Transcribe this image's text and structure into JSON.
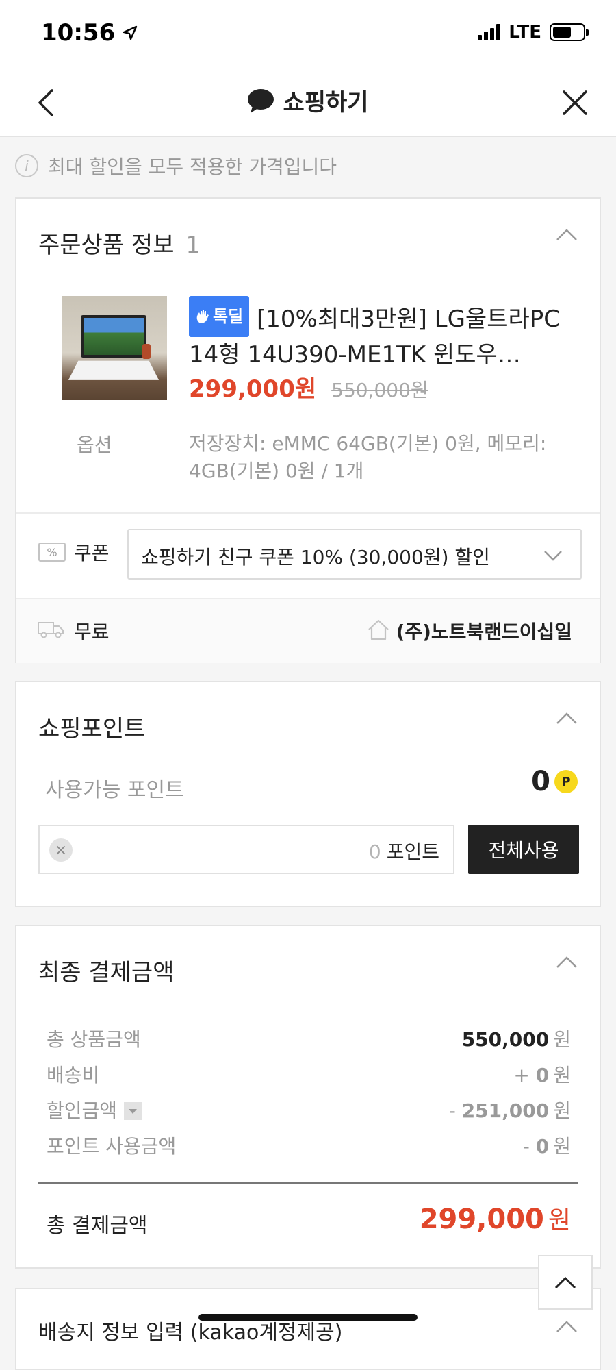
{
  "status_bar": {
    "time": "10:56",
    "network": "LTE"
  },
  "navbar": {
    "title": "쇼핑하기"
  },
  "notice": {
    "text": "최대 할인을 모두 적용한 가격입니다",
    "icon": "info-icon"
  },
  "order": {
    "title": "주문상품 정보",
    "count": "1",
    "product": {
      "badge": "톡딜",
      "name": "[10%최대3만원] LG울트라PC 14형 14U390-ME1TK 윈도우…",
      "sale_price": "299,000원",
      "original_price": "550,000원",
      "option_label": "옵션",
      "option_text": "저장장치: eMMC 64GB(기본) 0원, 메모리: 4GB(기본) 0원 / 1개"
    },
    "coupon": {
      "label": "쿠폰",
      "selected": "쇼핑하기 친구 쿠폰 10% (30,000원) 할인"
    },
    "shipping": {
      "label": "무료",
      "seller": "(주)노트북랜드이십일"
    }
  },
  "points": {
    "title": "쇼핑포인트",
    "available_label": "사용가능 포인트",
    "available_value": "0",
    "point_badge": "P",
    "input_value": "0",
    "input_unit": "포인트",
    "use_all_label": "전체사용"
  },
  "final": {
    "title": "최종 결제금액",
    "rows": [
      {
        "label": "총 상품금액",
        "prefix": "",
        "amount": "550,000",
        "unit": "원"
      },
      {
        "label": "배송비",
        "prefix": "+ ",
        "amount": "0",
        "unit": "원"
      },
      {
        "label": "할인금액",
        "prefix": "- ",
        "amount": "251,000",
        "unit": "원"
      },
      {
        "label": "포인트 사용금액",
        "prefix": "- ",
        "amount": "0",
        "unit": "원"
      }
    ],
    "total_label": "총 결제금액",
    "total_amount": "299,000",
    "total_unit": "원"
  },
  "next_section": {
    "title": "배송지 정보 입력 (kakao계정제공)"
  },
  "colors": {
    "accent_red": "#e0462a",
    "deal_blue": "#3b7ef5",
    "point_yellow": "#f7d81d",
    "dark_button": "#222222"
  }
}
